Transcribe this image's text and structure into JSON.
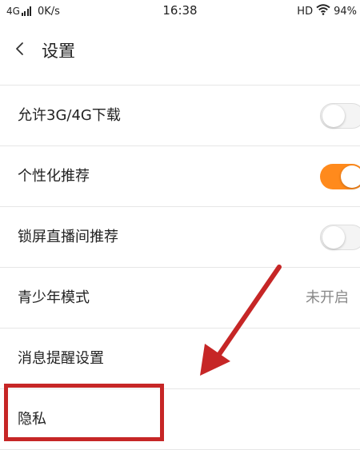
{
  "status_bar": {
    "network": "4G",
    "speed": "0K/s",
    "time": "16:38",
    "hd": "HD",
    "battery": "94%"
  },
  "header": {
    "title": "设置"
  },
  "settings": {
    "items": [
      {
        "label": "允许3G/4G下载",
        "control": "toggle",
        "on": false
      },
      {
        "label": "个性化推荐",
        "control": "toggle",
        "on": true
      },
      {
        "label": "锁屏直播间推荐",
        "control": "toggle",
        "on": false
      },
      {
        "label": "青少年模式",
        "control": "value",
        "value": "未开启"
      },
      {
        "label": "消息提醒设置",
        "control": "none"
      },
      {
        "label": "隐私",
        "control": "none"
      }
    ]
  },
  "colors": {
    "toggle_on": "#ff8a1c",
    "annotation": "#c62626"
  }
}
